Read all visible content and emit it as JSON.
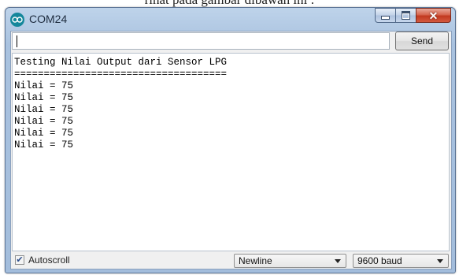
{
  "caption": "rihat pada gambar dibawah ini :",
  "window": {
    "title": "COM24",
    "app_icon": "arduino-icon",
    "controls": {
      "minimize": "minimize-icon",
      "maximize": "maximize-icon",
      "close": "close-icon"
    }
  },
  "send_bar": {
    "input_value": "",
    "send_label": "Send"
  },
  "console": {
    "lines": [
      "Testing Nilai Output dari Sensor LPG",
      "====================================",
      "Nilai = 75",
      "Nilai = 75",
      "Nilai = 75",
      "Nilai = 75",
      "Nilai = 75",
      "Nilai = 75"
    ]
  },
  "footer": {
    "autoscroll_label": "Autoscroll",
    "autoscroll_checked": true,
    "line_ending": "Newline",
    "baud_rate": "9600 baud"
  }
}
